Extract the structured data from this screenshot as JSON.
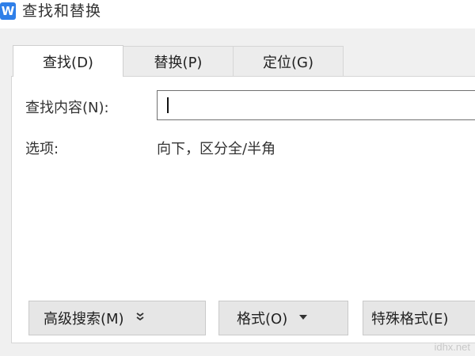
{
  "window": {
    "title": "查找和替换",
    "app_icon": "W",
    "icon_color": "#2f7fe8"
  },
  "tabs": [
    {
      "label": "查找(D)",
      "active": true
    },
    {
      "label": "替换(P)",
      "active": false
    },
    {
      "label": "定位(G)",
      "active": false
    }
  ],
  "find": {
    "label": "查找内容(N):",
    "value": ""
  },
  "options": {
    "label": "选项:",
    "value": "向下，区分全/半角"
  },
  "buttons": {
    "advanced_search": "高级搜索(M)",
    "advanced_search_icon": "double-chevron-down-icon",
    "format": "格式(O)",
    "format_icon": "triangle-down-icon",
    "special_format": "特殊格式(E)"
  },
  "watermark": "idhx.net"
}
